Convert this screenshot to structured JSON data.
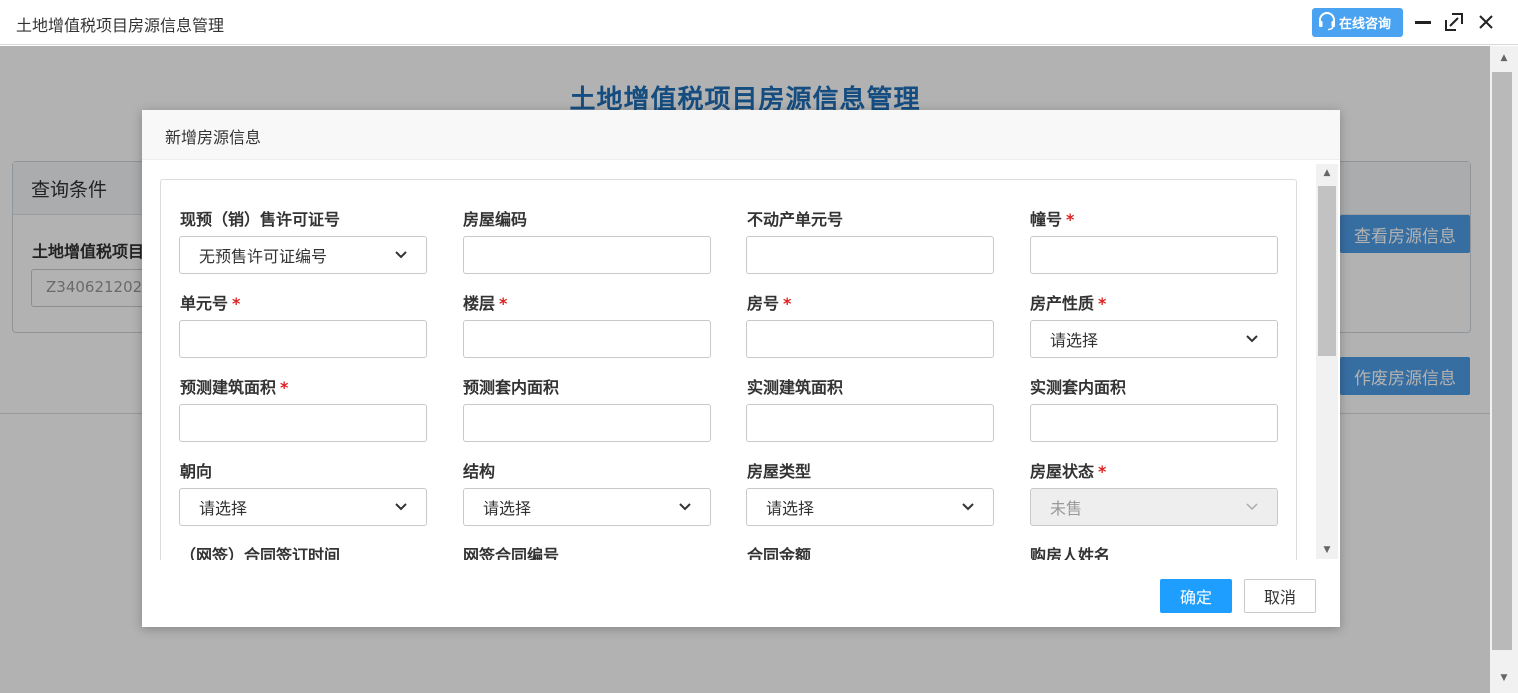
{
  "window": {
    "title": "土地增值税项目房源信息管理",
    "consult_label": "在线咨询"
  },
  "page": {
    "title": "土地增值税项目房源信息管理",
    "query_panel_title": "查询条件",
    "query_field_label": "土地增值税项目",
    "query_field_value": "Z340621202",
    "view_button": "查看房源信息",
    "void_button": "作废房源信息"
  },
  "modal": {
    "title": "新增房源信息",
    "ok_label": "确定",
    "cancel_label": "取消",
    "fields": [
      {
        "label": "现预（销）售许可证号",
        "required": false,
        "type": "select",
        "value": "无预售许可证编号"
      },
      {
        "label": "房屋编码",
        "required": false,
        "type": "input",
        "value": ""
      },
      {
        "label": "不动产单元号",
        "required": false,
        "type": "input",
        "value": ""
      },
      {
        "label": "幢号",
        "required": true,
        "type": "input",
        "value": ""
      },
      {
        "label": "单元号",
        "required": true,
        "type": "input",
        "value": ""
      },
      {
        "label": "楼层",
        "required": true,
        "type": "input",
        "value": ""
      },
      {
        "label": "房号",
        "required": true,
        "type": "input",
        "value": ""
      },
      {
        "label": "房产性质",
        "required": true,
        "type": "select",
        "value": "请选择"
      },
      {
        "label": "预测建筑面积",
        "required": true,
        "type": "input",
        "value": ""
      },
      {
        "label": "预测套内面积",
        "required": false,
        "type": "input",
        "value": ""
      },
      {
        "label": "实测建筑面积",
        "required": false,
        "type": "input",
        "value": ""
      },
      {
        "label": "实测套内面积",
        "required": false,
        "type": "input",
        "value": ""
      },
      {
        "label": "朝向",
        "required": false,
        "type": "select",
        "value": "请选择"
      },
      {
        "label": "结构",
        "required": false,
        "type": "select",
        "value": "请选择"
      },
      {
        "label": "房屋类型",
        "required": false,
        "type": "select",
        "value": "请选择"
      },
      {
        "label": "房屋状态",
        "required": true,
        "type": "select-disabled",
        "value": "未售"
      },
      {
        "label": "（网签）合同签订时间",
        "required": false,
        "type": "input",
        "value": ""
      },
      {
        "label": "网签合同编号",
        "required": false,
        "type": "input",
        "value": ""
      },
      {
        "label": "合同金额",
        "required": false,
        "type": "input",
        "value": ""
      },
      {
        "label": "购房人姓名",
        "required": false,
        "type": "input",
        "value": ""
      }
    ]
  },
  "icons": {
    "consult": "headset-icon",
    "minimize": "minimize-icon",
    "maximize": "maximize-icon",
    "close": "close-icon",
    "dropdown": "chevron-down-icon"
  },
  "colors": {
    "accent": "#1e9fff",
    "page_title": "#1f6fb8",
    "required": "#e02020",
    "bg_button": "#4f9ee8"
  }
}
